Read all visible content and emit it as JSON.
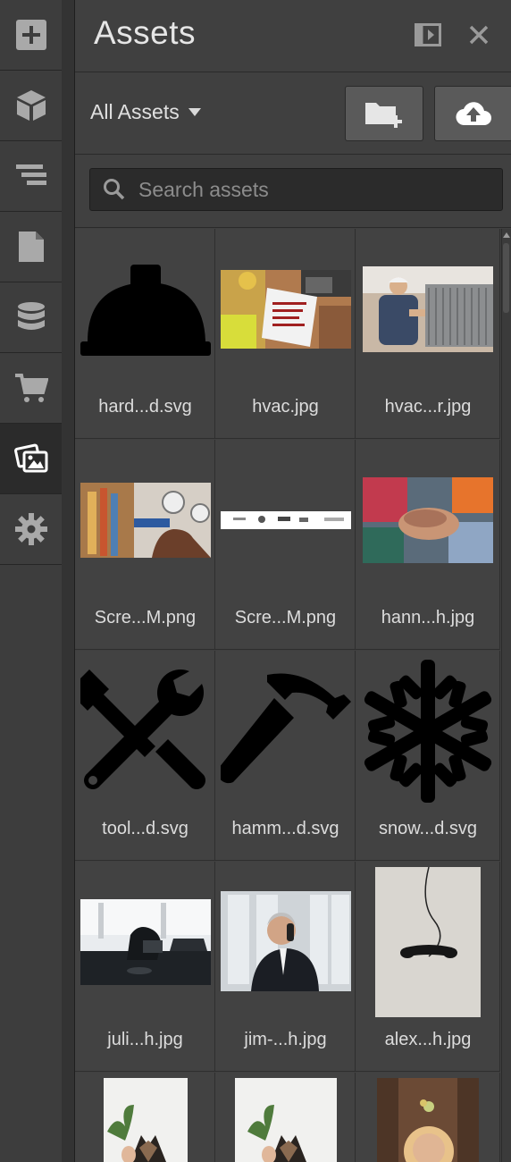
{
  "rail": {
    "items": [
      {
        "name": "add-icon"
      },
      {
        "name": "cube-icon"
      },
      {
        "name": "navigator-icon"
      },
      {
        "name": "page-icon"
      },
      {
        "name": "database-icon"
      },
      {
        "name": "cart-icon"
      },
      {
        "name": "assets-icon",
        "active": true
      },
      {
        "name": "gear-icon"
      }
    ]
  },
  "panel": {
    "title": "Assets",
    "filter_label": "All Assets",
    "search_placeholder": "Search assets"
  },
  "assets": [
    {
      "name": "hard...d.svg",
      "kind": "hardhat-svg"
    },
    {
      "name": "hvac.jpg",
      "kind": "photo"
    },
    {
      "name": "hvac...r.jpg",
      "kind": "photo"
    },
    {
      "name": "Scre...M.png",
      "kind": "photo"
    },
    {
      "name": "Scre...M.png",
      "kind": "strip"
    },
    {
      "name": "hann...h.jpg",
      "kind": "photo"
    },
    {
      "name": "tool...d.svg",
      "kind": "tools-svg"
    },
    {
      "name": "hamm...d.svg",
      "kind": "hammer-svg"
    },
    {
      "name": "snow...d.svg",
      "kind": "snowflake-svg"
    },
    {
      "name": "juli...h.jpg",
      "kind": "photo"
    },
    {
      "name": "jim-...h.jpg",
      "kind": "photo"
    },
    {
      "name": "alex...h.jpg",
      "kind": "photo"
    },
    {
      "name": "",
      "kind": "photo"
    },
    {
      "name": "",
      "kind": "photo"
    },
    {
      "name": "",
      "kind": "photo"
    }
  ],
  "colors": {
    "panel_bg": "#404040",
    "rail_active_bg": "#2b2b2b",
    "icon_gray": "#a9a9a9",
    "icon_white": "#ffffff"
  }
}
